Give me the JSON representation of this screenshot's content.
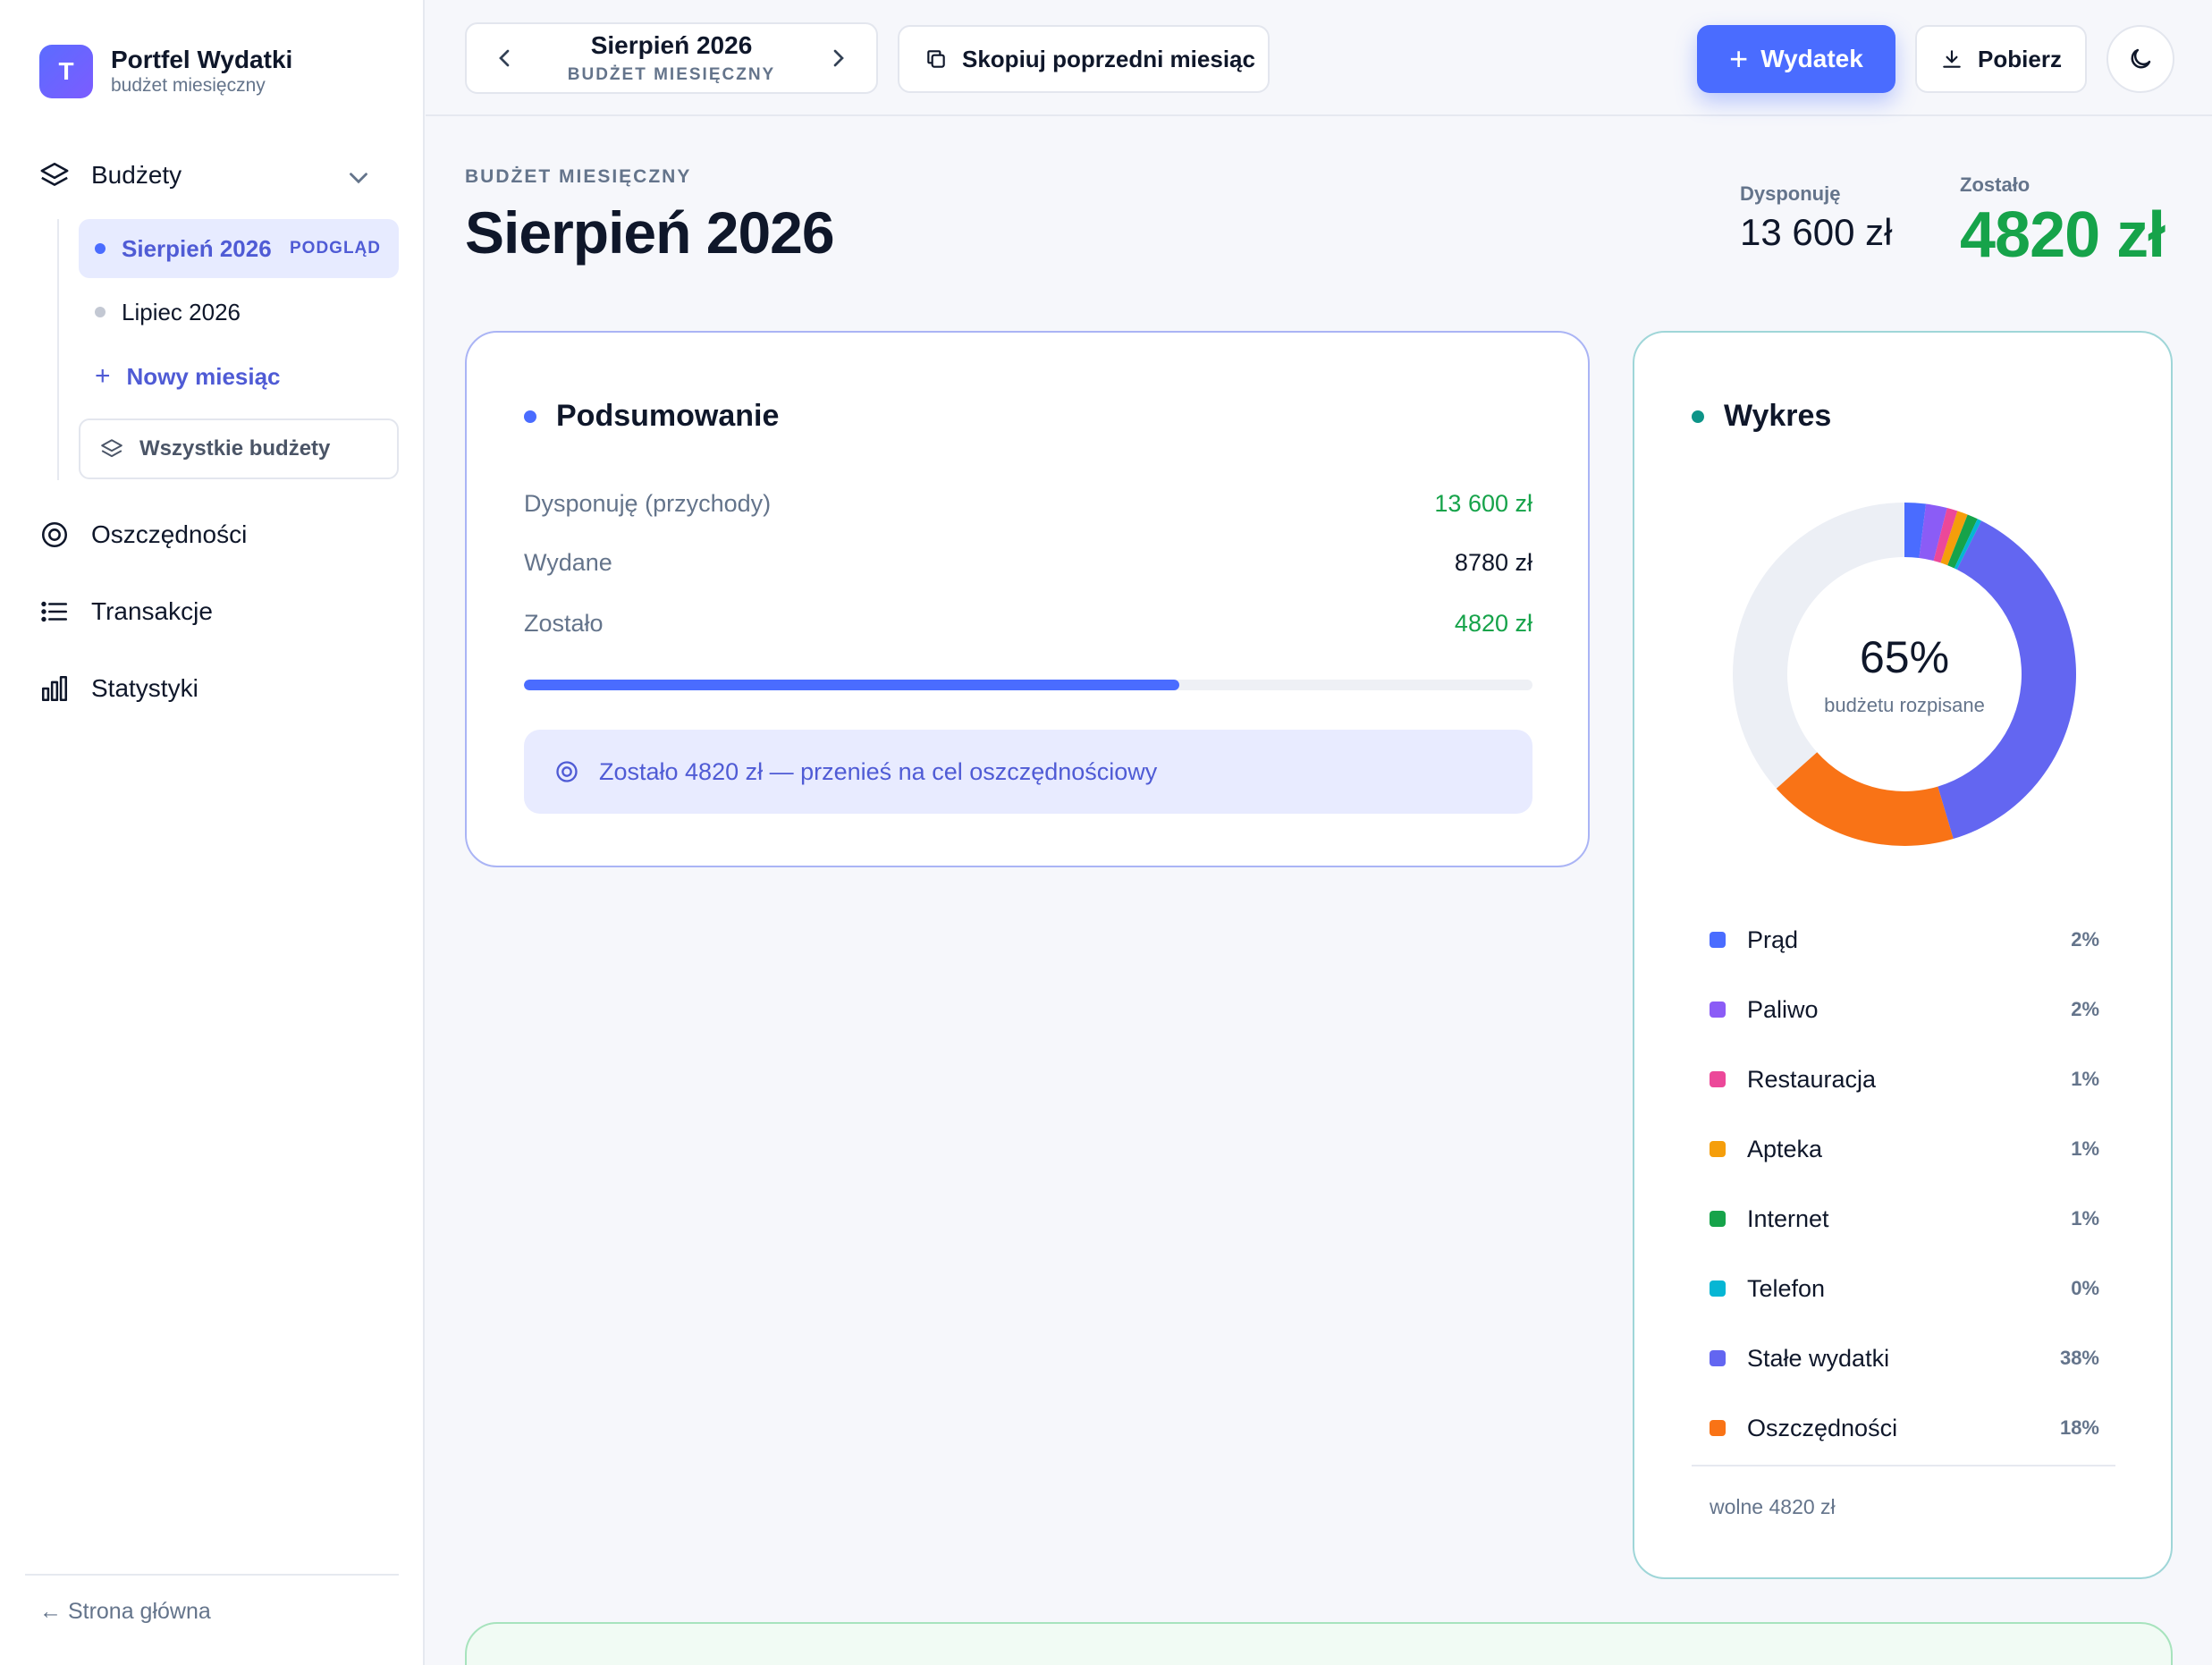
{
  "brand": {
    "initial": "T",
    "title": "Portfel Wydatki",
    "subtitle": "budżet miesięczny"
  },
  "sidebar": {
    "budgets_label": "Budżety",
    "sub_items": [
      {
        "label": "Sierpień 2026",
        "badge": "PODGLĄD",
        "active": true
      },
      {
        "label": "Lipiec 2026",
        "active": false
      }
    ],
    "new_month": "Nowy miesiąc",
    "all_budgets": "Wszystkie budżety",
    "nav": [
      {
        "label": "Oszczędności",
        "icon": "target-icon"
      },
      {
        "label": "Transakcje",
        "icon": "list-icon"
      },
      {
        "label": "Statystyki",
        "icon": "bar-chart-icon"
      }
    ],
    "home_link": "← Strona główna"
  },
  "topbar": {
    "month_title": "Sierpień 2026",
    "month_sub": "BUDŻET MIESIĘCZNY",
    "copy_label": "Skopiuj poprzedni miesiąc",
    "add_label": "Wydatek",
    "download_label": "Pobierz"
  },
  "header": {
    "eyebrow": "BUDŻET MIESIĘCZNY",
    "title": "Sierpień 2026",
    "available_label": "Dysponuję",
    "available_value": "13 600 zł",
    "left_label": "Zostało",
    "left_value": "4820 zł"
  },
  "summary": {
    "title": "Podsumowanie",
    "rows": [
      {
        "label": "Dysponuję (przychody)",
        "value": "13 600 zł"
      },
      {
        "label": "Wydane",
        "value": "8780 zł"
      },
      {
        "label": "Zostało",
        "value": "4820 zł"
      }
    ],
    "progress_percent": 65,
    "hint": "Zostało 4820 zł — przenieś na cel oszczędnościowy"
  },
  "chart": {
    "title": "Wykres",
    "center_percent": "65%",
    "center_label": "budżetu rozpisane",
    "free_note": "wolne 4820 zł"
  },
  "chart_data": {
    "type": "pie",
    "total_allocated_percent": 65,
    "slices": [
      {
        "name": "Prąd",
        "percent": 2,
        "label": "2%",
        "color": "#4a6cff"
      },
      {
        "name": "Paliwo",
        "percent": 2,
        "label": "2%",
        "color": "#8b5cf6"
      },
      {
        "name": "Restauracja",
        "percent": 1,
        "label": "1%",
        "color": "#ec4899"
      },
      {
        "name": "Apteka",
        "percent": 1,
        "label": "1%",
        "color": "#f59e0b"
      },
      {
        "name": "Internet",
        "percent": 1,
        "label": "1%",
        "color": "#16a34a"
      },
      {
        "name": "Telefon",
        "percent": 0,
        "label": "0%",
        "color": "#06b6d4"
      },
      {
        "name": "Stałe wydatki",
        "percent": 38,
        "label": "38%",
        "color": "#6366f1"
      },
      {
        "name": "Oszczędności",
        "percent": 18,
        "label": "18%",
        "color": "#f97316"
      }
    ],
    "remainder_color": "#eceff5"
  },
  "colors": {
    "accent": "#4a6cff",
    "success": "#16a34a",
    "teal": "#0d9488"
  }
}
